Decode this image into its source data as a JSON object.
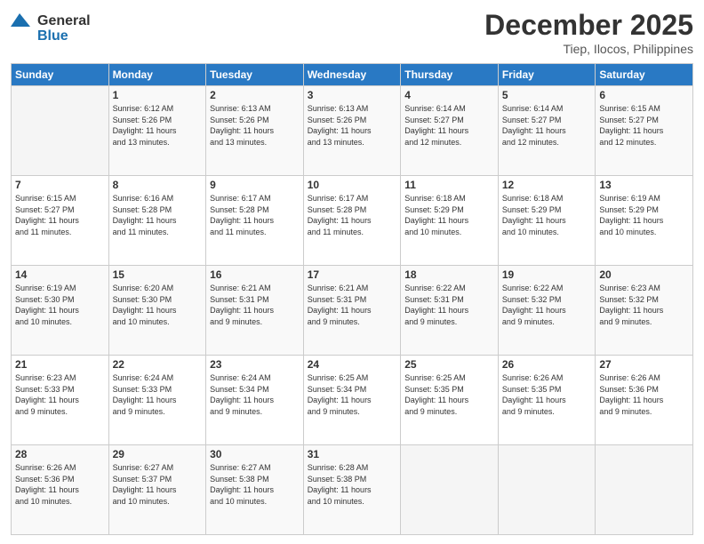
{
  "header": {
    "logo_general": "General",
    "logo_blue": "Blue",
    "month": "December 2025",
    "location": "Tiep, Ilocos, Philippines"
  },
  "days_of_week": [
    "Sunday",
    "Monday",
    "Tuesday",
    "Wednesday",
    "Thursday",
    "Friday",
    "Saturday"
  ],
  "weeks": [
    [
      {
        "num": "",
        "info": ""
      },
      {
        "num": "1",
        "info": "Sunrise: 6:12 AM\nSunset: 5:26 PM\nDaylight: 11 hours\nand 13 minutes."
      },
      {
        "num": "2",
        "info": "Sunrise: 6:13 AM\nSunset: 5:26 PM\nDaylight: 11 hours\nand 13 minutes."
      },
      {
        "num": "3",
        "info": "Sunrise: 6:13 AM\nSunset: 5:26 PM\nDaylight: 11 hours\nand 13 minutes."
      },
      {
        "num": "4",
        "info": "Sunrise: 6:14 AM\nSunset: 5:27 PM\nDaylight: 11 hours\nand 12 minutes."
      },
      {
        "num": "5",
        "info": "Sunrise: 6:14 AM\nSunset: 5:27 PM\nDaylight: 11 hours\nand 12 minutes."
      },
      {
        "num": "6",
        "info": "Sunrise: 6:15 AM\nSunset: 5:27 PM\nDaylight: 11 hours\nand 12 minutes."
      }
    ],
    [
      {
        "num": "7",
        "info": "Sunrise: 6:15 AM\nSunset: 5:27 PM\nDaylight: 11 hours\nand 11 minutes."
      },
      {
        "num": "8",
        "info": "Sunrise: 6:16 AM\nSunset: 5:28 PM\nDaylight: 11 hours\nand 11 minutes."
      },
      {
        "num": "9",
        "info": "Sunrise: 6:17 AM\nSunset: 5:28 PM\nDaylight: 11 hours\nand 11 minutes."
      },
      {
        "num": "10",
        "info": "Sunrise: 6:17 AM\nSunset: 5:28 PM\nDaylight: 11 hours\nand 11 minutes."
      },
      {
        "num": "11",
        "info": "Sunrise: 6:18 AM\nSunset: 5:29 PM\nDaylight: 11 hours\nand 10 minutes."
      },
      {
        "num": "12",
        "info": "Sunrise: 6:18 AM\nSunset: 5:29 PM\nDaylight: 11 hours\nand 10 minutes."
      },
      {
        "num": "13",
        "info": "Sunrise: 6:19 AM\nSunset: 5:29 PM\nDaylight: 11 hours\nand 10 minutes."
      }
    ],
    [
      {
        "num": "14",
        "info": "Sunrise: 6:19 AM\nSunset: 5:30 PM\nDaylight: 11 hours\nand 10 minutes."
      },
      {
        "num": "15",
        "info": "Sunrise: 6:20 AM\nSunset: 5:30 PM\nDaylight: 11 hours\nand 10 minutes."
      },
      {
        "num": "16",
        "info": "Sunrise: 6:21 AM\nSunset: 5:31 PM\nDaylight: 11 hours\nand 9 minutes."
      },
      {
        "num": "17",
        "info": "Sunrise: 6:21 AM\nSunset: 5:31 PM\nDaylight: 11 hours\nand 9 minutes."
      },
      {
        "num": "18",
        "info": "Sunrise: 6:22 AM\nSunset: 5:31 PM\nDaylight: 11 hours\nand 9 minutes."
      },
      {
        "num": "19",
        "info": "Sunrise: 6:22 AM\nSunset: 5:32 PM\nDaylight: 11 hours\nand 9 minutes."
      },
      {
        "num": "20",
        "info": "Sunrise: 6:23 AM\nSunset: 5:32 PM\nDaylight: 11 hours\nand 9 minutes."
      }
    ],
    [
      {
        "num": "21",
        "info": "Sunrise: 6:23 AM\nSunset: 5:33 PM\nDaylight: 11 hours\nand 9 minutes."
      },
      {
        "num": "22",
        "info": "Sunrise: 6:24 AM\nSunset: 5:33 PM\nDaylight: 11 hours\nand 9 minutes."
      },
      {
        "num": "23",
        "info": "Sunrise: 6:24 AM\nSunset: 5:34 PM\nDaylight: 11 hours\nand 9 minutes."
      },
      {
        "num": "24",
        "info": "Sunrise: 6:25 AM\nSunset: 5:34 PM\nDaylight: 11 hours\nand 9 minutes."
      },
      {
        "num": "25",
        "info": "Sunrise: 6:25 AM\nSunset: 5:35 PM\nDaylight: 11 hours\nand 9 minutes."
      },
      {
        "num": "26",
        "info": "Sunrise: 6:26 AM\nSunset: 5:35 PM\nDaylight: 11 hours\nand 9 minutes."
      },
      {
        "num": "27",
        "info": "Sunrise: 6:26 AM\nSunset: 5:36 PM\nDaylight: 11 hours\nand 9 minutes."
      }
    ],
    [
      {
        "num": "28",
        "info": "Sunrise: 6:26 AM\nSunset: 5:36 PM\nDaylight: 11 hours\nand 10 minutes."
      },
      {
        "num": "29",
        "info": "Sunrise: 6:27 AM\nSunset: 5:37 PM\nDaylight: 11 hours\nand 10 minutes."
      },
      {
        "num": "30",
        "info": "Sunrise: 6:27 AM\nSunset: 5:38 PM\nDaylight: 11 hours\nand 10 minutes."
      },
      {
        "num": "31",
        "info": "Sunrise: 6:28 AM\nSunset: 5:38 PM\nDaylight: 11 hours\nand 10 minutes."
      },
      {
        "num": "",
        "info": ""
      },
      {
        "num": "",
        "info": ""
      },
      {
        "num": "",
        "info": ""
      }
    ]
  ]
}
